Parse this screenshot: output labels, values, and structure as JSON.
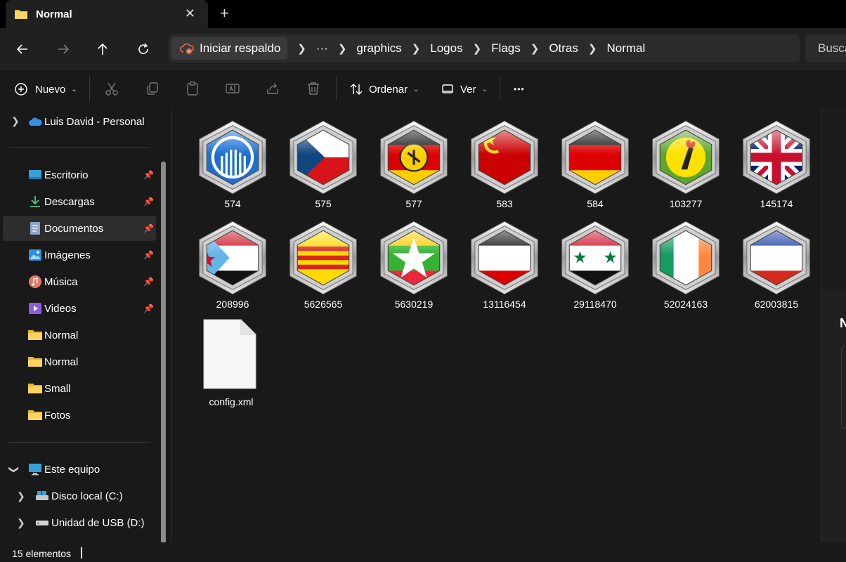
{
  "titlebar": {
    "tab_title": "Normal",
    "close_glyph": "✕",
    "new_tab_glyph": "+"
  },
  "address": {
    "backup_label": "Iniciar respaldo",
    "ellipsis": "···",
    "crumbs": [
      "graphics",
      "Logos",
      "Flags",
      "Otras",
      "Normal"
    ],
    "search_placeholder": "Buscar en Normal"
  },
  "toolbar": {
    "new_label": "Nuevo",
    "sort_label": "Ordenar",
    "view_label": "Ver",
    "more_glyph": "•••"
  },
  "sidebar": {
    "account": "Luis David - Personal",
    "quick": [
      {
        "label": "Escritorio",
        "icon": "desktop-icon",
        "pinned": true
      },
      {
        "label": "Descargas",
        "icon": "download-icon",
        "pinned": true
      },
      {
        "label": "Documentos",
        "icon": "documents-icon",
        "pinned": true
      },
      {
        "label": "Imágenes",
        "icon": "pictures-icon",
        "pinned": true
      },
      {
        "label": "Música",
        "icon": "music-icon",
        "pinned": true
      },
      {
        "label": "Videos",
        "icon": "videos-icon",
        "pinned": true
      },
      {
        "label": "Normal",
        "icon": "folder-icon",
        "pinned": false
      },
      {
        "label": "Normal",
        "icon": "folder-icon",
        "pinned": false
      },
      {
        "label": "Small",
        "icon": "folder-icon",
        "pinned": false
      },
      {
        "label": "Fotos",
        "icon": "folder-icon",
        "pinned": false
      }
    ],
    "this_pc": "Este equipo",
    "drives": [
      "Disco local (C:)",
      "Unidad de USB (D:)"
    ]
  },
  "files": [
    {
      "name": "574",
      "flag": "cis"
    },
    {
      "name": "575",
      "flag": "czech"
    },
    {
      "name": "577",
      "flag": "east-germany"
    },
    {
      "name": "583",
      "flag": "soviet"
    },
    {
      "name": "584",
      "flag": "germany"
    },
    {
      "name": "103277",
      "flag": "zanu"
    },
    {
      "name": "145174",
      "flag": "uk"
    },
    {
      "name": "208996",
      "flag": "south-yemen"
    },
    {
      "name": "5626565",
      "flag": "south-vietnam"
    },
    {
      "name": "5630219",
      "flag": "myanmar"
    },
    {
      "name": "13116454",
      "flag": "german-empire"
    },
    {
      "name": "29118470",
      "flag": "syria"
    },
    {
      "name": "52024163",
      "flag": "ireland"
    },
    {
      "name": "62003815",
      "flag": "blue-white-red"
    }
  ],
  "config_file": "config.xml",
  "details_initial": "N",
  "status": {
    "count": "15 elementos"
  },
  "colors": {
    "accent": "#4cc2ff",
    "folder": "#f5c542"
  }
}
